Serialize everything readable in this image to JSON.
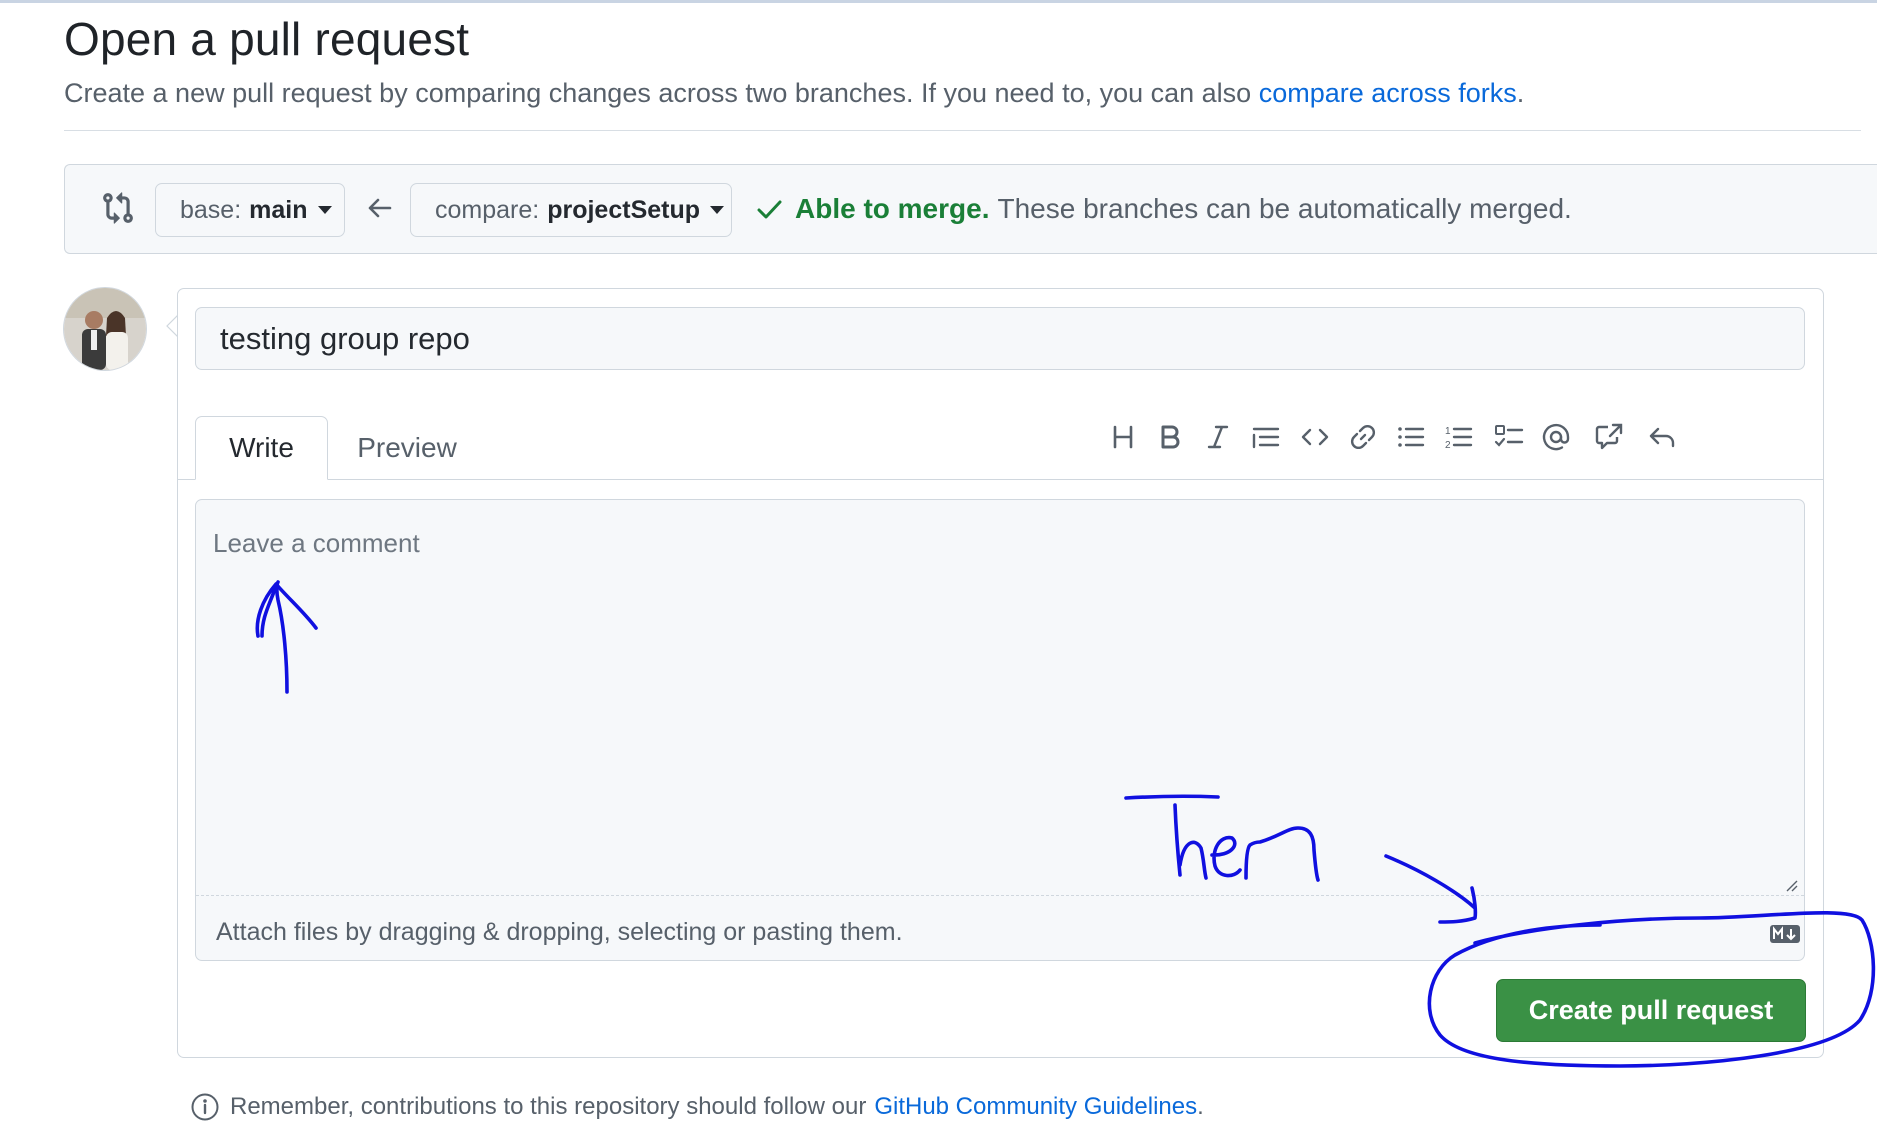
{
  "page": {
    "title": "Open a pull request",
    "subtitle": "Create a new pull request by comparing changes across two branches. If you need to, you can also",
    "subtitle_link": "compare across forks",
    "subtitle_end": "."
  },
  "range": {
    "icon": "git-compare-icon",
    "base_prefix": "base:",
    "base_branch": "main",
    "compare_prefix": "compare:",
    "compare_branch": "projectSetup",
    "merge_ok": "Able to merge.",
    "merge_message": "These branches can be automatically merged.",
    "merge_color": "#1a7f37"
  },
  "form": {
    "title_value": "testing group repo",
    "tabs": [
      {
        "label": "Write",
        "active": true
      },
      {
        "label": "Preview",
        "active": false
      }
    ],
    "toolbar": [
      "heading-icon",
      "bold-icon",
      "italic-icon",
      "quote-icon",
      "code-icon",
      "link-icon",
      "unordered-list-icon",
      "ordered-list-icon",
      "task-list-icon",
      "mention-icon",
      "cross-reference-icon",
      "reply-icon"
    ],
    "comment_placeholder": "Leave a comment",
    "attach_hint": "Attach files by dragging & dropping, selecting or pasting them.",
    "submit_label": "Create pull request",
    "submit_color": "#3a9145"
  },
  "footer": {
    "remember": "Remember, contributions to this repository should follow our",
    "guidelines_link": "GitHub Community Guidelines",
    "end": "."
  },
  "annotation": {
    "handwritten_text": "Then",
    "ink_color": "#1010e0"
  }
}
